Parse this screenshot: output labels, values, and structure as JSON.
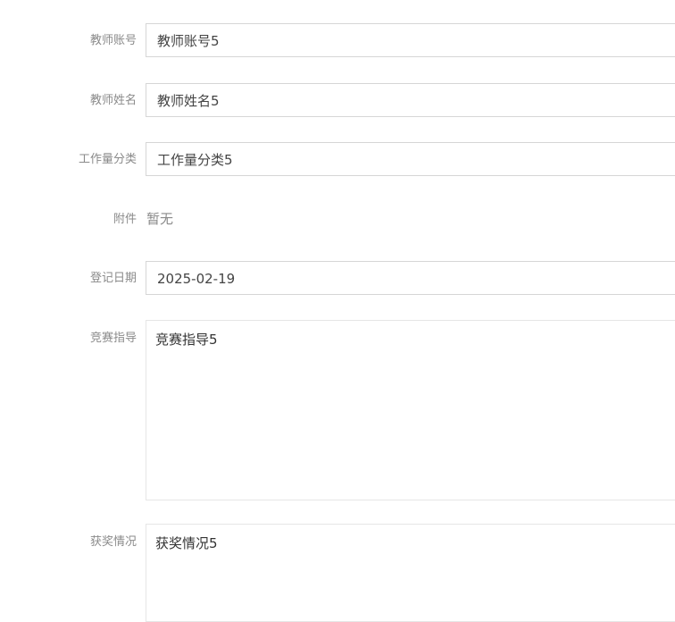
{
  "form": {
    "teacher_account": {
      "label": "教师账号",
      "value": "教师账号5"
    },
    "teacher_name": {
      "label": "教师姓名",
      "value": "教师姓名5"
    },
    "workload_category": {
      "label": "工作量分类",
      "value": "工作量分类5"
    },
    "attachment": {
      "label": "附件",
      "value": "暂无"
    },
    "register_date": {
      "label": "登记日期",
      "value": "2025-02-19"
    },
    "competition_guidance": {
      "label": "竞赛指导",
      "value": "竞赛指导5"
    },
    "award_status": {
      "label": "获奖情况",
      "value": "获奖情况5"
    }
  }
}
